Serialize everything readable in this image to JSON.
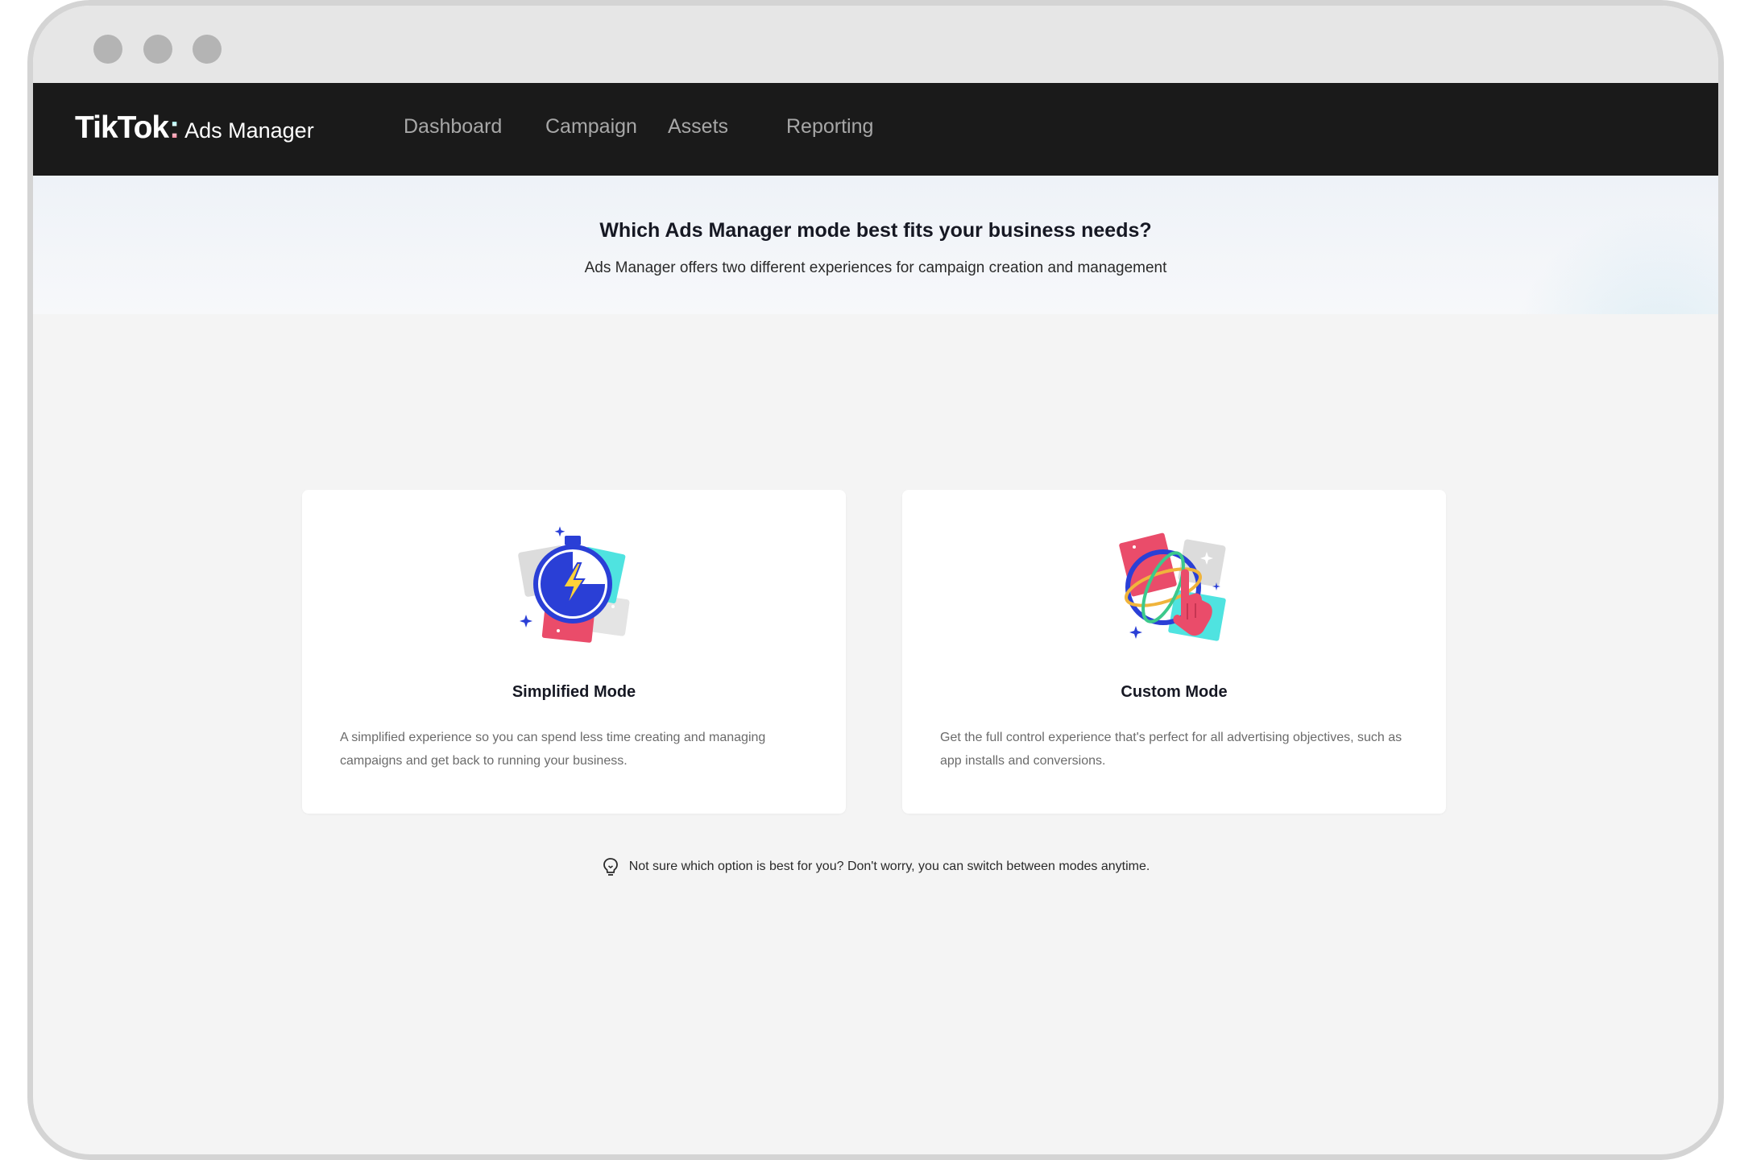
{
  "nav": {
    "brand": "TikTok",
    "colon": ":",
    "product": "Ads Manager",
    "items": [
      {
        "label": "Dashboard"
      },
      {
        "label": "Campaign"
      },
      {
        "label": "Assets"
      },
      {
        "label": "Reporting"
      }
    ]
  },
  "hero": {
    "title": "Which Ads Manager mode best fits your business needs?",
    "subtitle": "Ads Manager offers two different experiences for campaign creation and management"
  },
  "cards": [
    {
      "icon": "stopwatch-lightning-icon",
      "title": "Simplified Mode",
      "description": "A simplified experience so you can spend less time creating and managing campaigns and get back to running your business."
    },
    {
      "icon": "globe-pointer-hand-icon",
      "title": "Custom Mode",
      "description": "Get the full control experience that's perfect for all advertising objectives, such as app installs and conversions."
    }
  ],
  "tip": {
    "icon": "lightbulb-icon",
    "text": "Not sure which option is best for you? Don't worry, you can switch between modes anytime."
  },
  "colors": {
    "navbar": "#1a1a1a",
    "page_background": "#f4f4f4",
    "accent_red": "#fe2c55",
    "accent_cyan": "#25f4ee",
    "illustration_blue": "#2a3fd6"
  }
}
